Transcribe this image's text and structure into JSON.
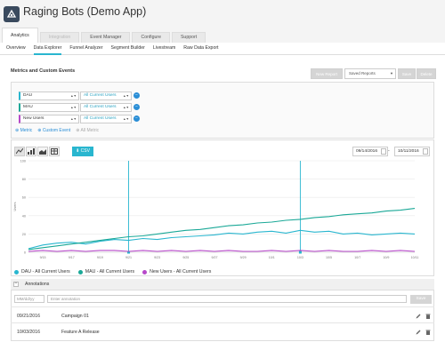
{
  "app": {
    "title": "Raging Bots (Demo App)",
    "tabs": [
      {
        "label": "Analytics",
        "state": "active"
      },
      {
        "label": "Integration",
        "state": "disabled"
      },
      {
        "label": "Event Manager",
        "state": "normal"
      },
      {
        "label": "Configure",
        "state": "normal"
      },
      {
        "label": "Support",
        "state": "normal"
      }
    ]
  },
  "subnav": [
    "Overview",
    "Data Explorer",
    "Funnel Analyzer",
    "Segment Builder",
    "Livestream",
    "Raw Data Export"
  ],
  "section_title": "Metrics and Custom Events",
  "toolbar": {
    "new_report": "New Report",
    "saved_reports": "Saved Reports",
    "save": "Save",
    "delete": "Delete"
  },
  "metric_rows": [
    {
      "metric": "DAU",
      "segment": "All Current Users",
      "color": "#29b6cf"
    },
    {
      "metric": "MAU",
      "segment": "All Current Users",
      "color": "#1aa897"
    },
    {
      "metric": "New Users",
      "segment": "All Current Users",
      "color": "#b648c9"
    }
  ],
  "add_links": {
    "metric": "Metric",
    "custom_event": "Custom Event",
    "all_metric": "All Metric"
  },
  "chart_controls": {
    "csv": "CSV",
    "start_date": "09/14/2016",
    "end_date": "10/11/2016",
    "date_separator": "-"
  },
  "chart_data": {
    "type": "line",
    "xlabel": "",
    "ylabel": "Users",
    "ylim": [
      0,
      100
    ],
    "y_ticks": [
      0,
      20,
      40,
      60,
      80,
      100
    ],
    "x": [
      "9/14",
      "9/15",
      "9/16",
      "9/17",
      "9/18",
      "9/19",
      "9/20",
      "9/21",
      "9/22",
      "9/23",
      "9/24",
      "9/25",
      "9/26",
      "9/27",
      "9/28",
      "9/29",
      "9/30",
      "10/1",
      "10/2",
      "10/3",
      "10/4",
      "10/5",
      "10/6",
      "10/7",
      "10/8",
      "10/9",
      "10/10",
      "10/11"
    ],
    "x_tick_labels": [
      "9/15",
      "9/17",
      "9/19",
      "9/21",
      "9/23",
      "9/25",
      "9/27",
      "9/29",
      "10/1",
      "10/3",
      "10/5",
      "10/7",
      "10/9",
      "10/11"
    ],
    "annotation_markers": [
      "9/21",
      "10/3"
    ],
    "series": [
      {
        "name": "DAU - All Current Users",
        "color": "#29b6cf",
        "values": [
          4,
          8,
          10,
          11,
          9,
          12,
          14,
          13,
          15,
          14,
          16,
          17,
          18,
          19,
          21,
          20,
          22,
          23,
          21,
          24,
          22,
          23,
          20,
          21,
          19,
          20,
          21,
          20
        ]
      },
      {
        "name": "MAU - All Current Users",
        "color": "#1aa897",
        "values": [
          3,
          5,
          7,
          9,
          11,
          13,
          15,
          17,
          18,
          20,
          22,
          24,
          25,
          27,
          29,
          30,
          32,
          33,
          35,
          36,
          38,
          39,
          41,
          42,
          43,
          45,
          46,
          48
        ]
      },
      {
        "name": "New Users - All Current Users",
        "color": "#b648c9",
        "values": [
          1,
          2,
          1,
          2,
          1,
          2,
          2,
          1,
          2,
          1,
          2,
          1,
          2,
          1,
          2,
          1,
          1,
          2,
          1,
          2,
          1,
          2,
          1,
          1,
          2,
          1,
          2,
          1
        ]
      }
    ]
  },
  "annotations": {
    "title": "Annotations",
    "date_placeholder": "MM/dd/yy",
    "text_placeholder": "Enter annotation",
    "save": "Save",
    "rows": [
      {
        "date": "09/21/2016",
        "text": "Campaign 01"
      },
      {
        "date": "10/03/2016",
        "text": "Feature A Release"
      }
    ]
  }
}
